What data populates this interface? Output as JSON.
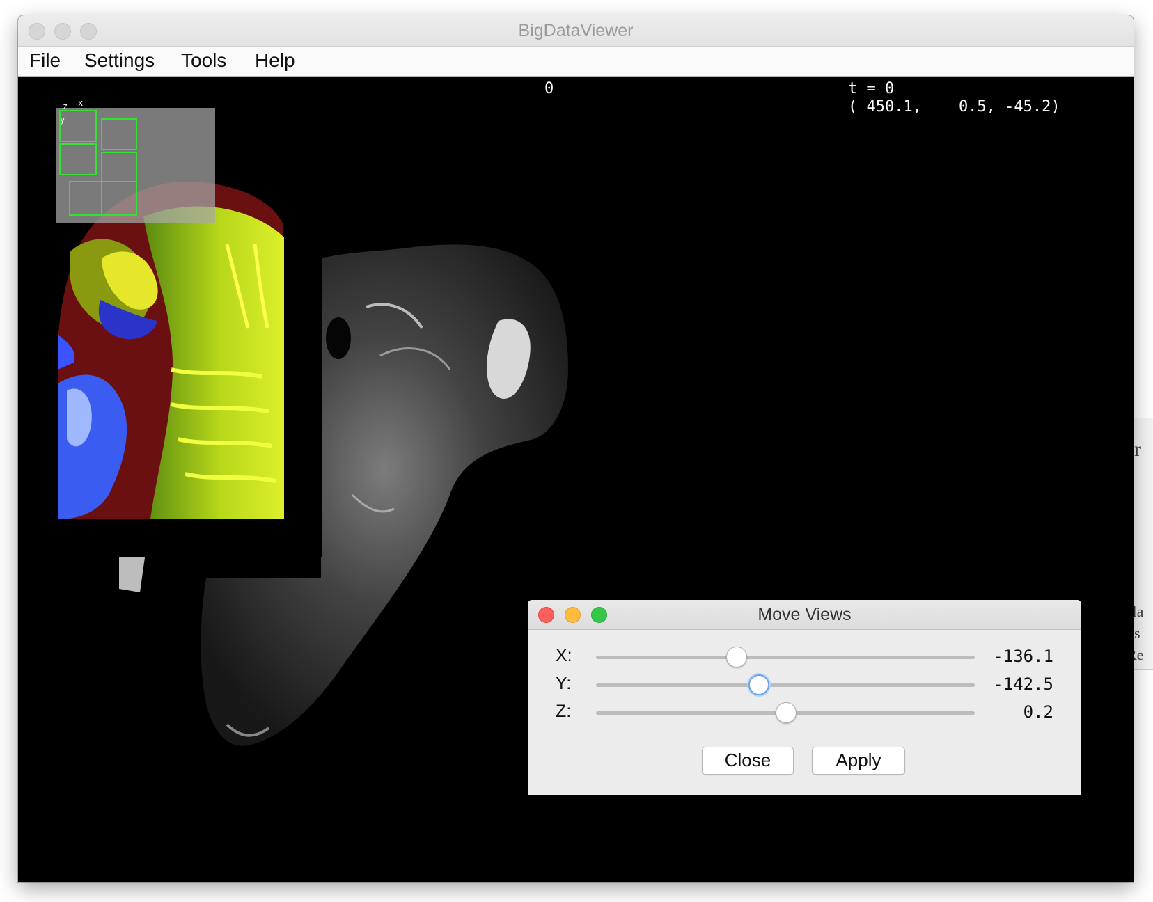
{
  "window": {
    "title": "BigDataViewer"
  },
  "menu": {
    "items": [
      "File",
      "Settings",
      "Tools",
      "Help"
    ]
  },
  "viewer": {
    "source_index": "0",
    "timepoint_label": "t = 0",
    "mouse_coords": "( 450.1,    0.5, -45.2)",
    "overview_axes": {
      "z": "z",
      "x": "x",
      "y": "y"
    }
  },
  "dialog": {
    "title": "Move Views",
    "sliders": [
      {
        "axis": "X:",
        "value": "-136.1",
        "position": 0.37
      },
      {
        "axis": "Y:",
        "value": "-142.5",
        "position": 0.43
      },
      {
        "axis": "Z:",
        "value": "0.2",
        "position": 0.5
      }
    ],
    "close_label": "Close",
    "apply_label": "Apply"
  },
  "background_window": {
    "text_top": "ur",
    "text_lines": [
      "sla",
      "ns",
      "Re"
    ]
  },
  "colors": {
    "traffic_close": "#fc605c",
    "traffic_minimize": "#fdbc40",
    "traffic_zoom": "#34c84a",
    "overview_box": "#35e035",
    "slider_focus": "#6ea4e6"
  }
}
